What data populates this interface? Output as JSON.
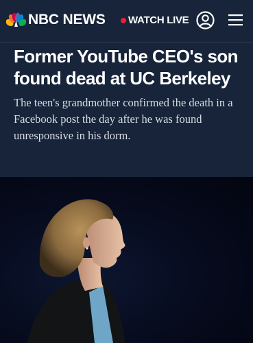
{
  "header": {
    "brand": "NBC NEWS",
    "watch_live_label": "WATCH LIVE",
    "live_indicator_color": "#e5213b",
    "background_color": "#172439",
    "account_icon": "account-circle-icon",
    "menu_icon": "hamburger-menu-icon"
  },
  "article": {
    "headline": "Former YouTube CEO's son found dead at UC Berkeley",
    "dek": "The teen's grandmother confirmed the death in a Facebook post the day after he was found unresponsive in his dorm."
  }
}
